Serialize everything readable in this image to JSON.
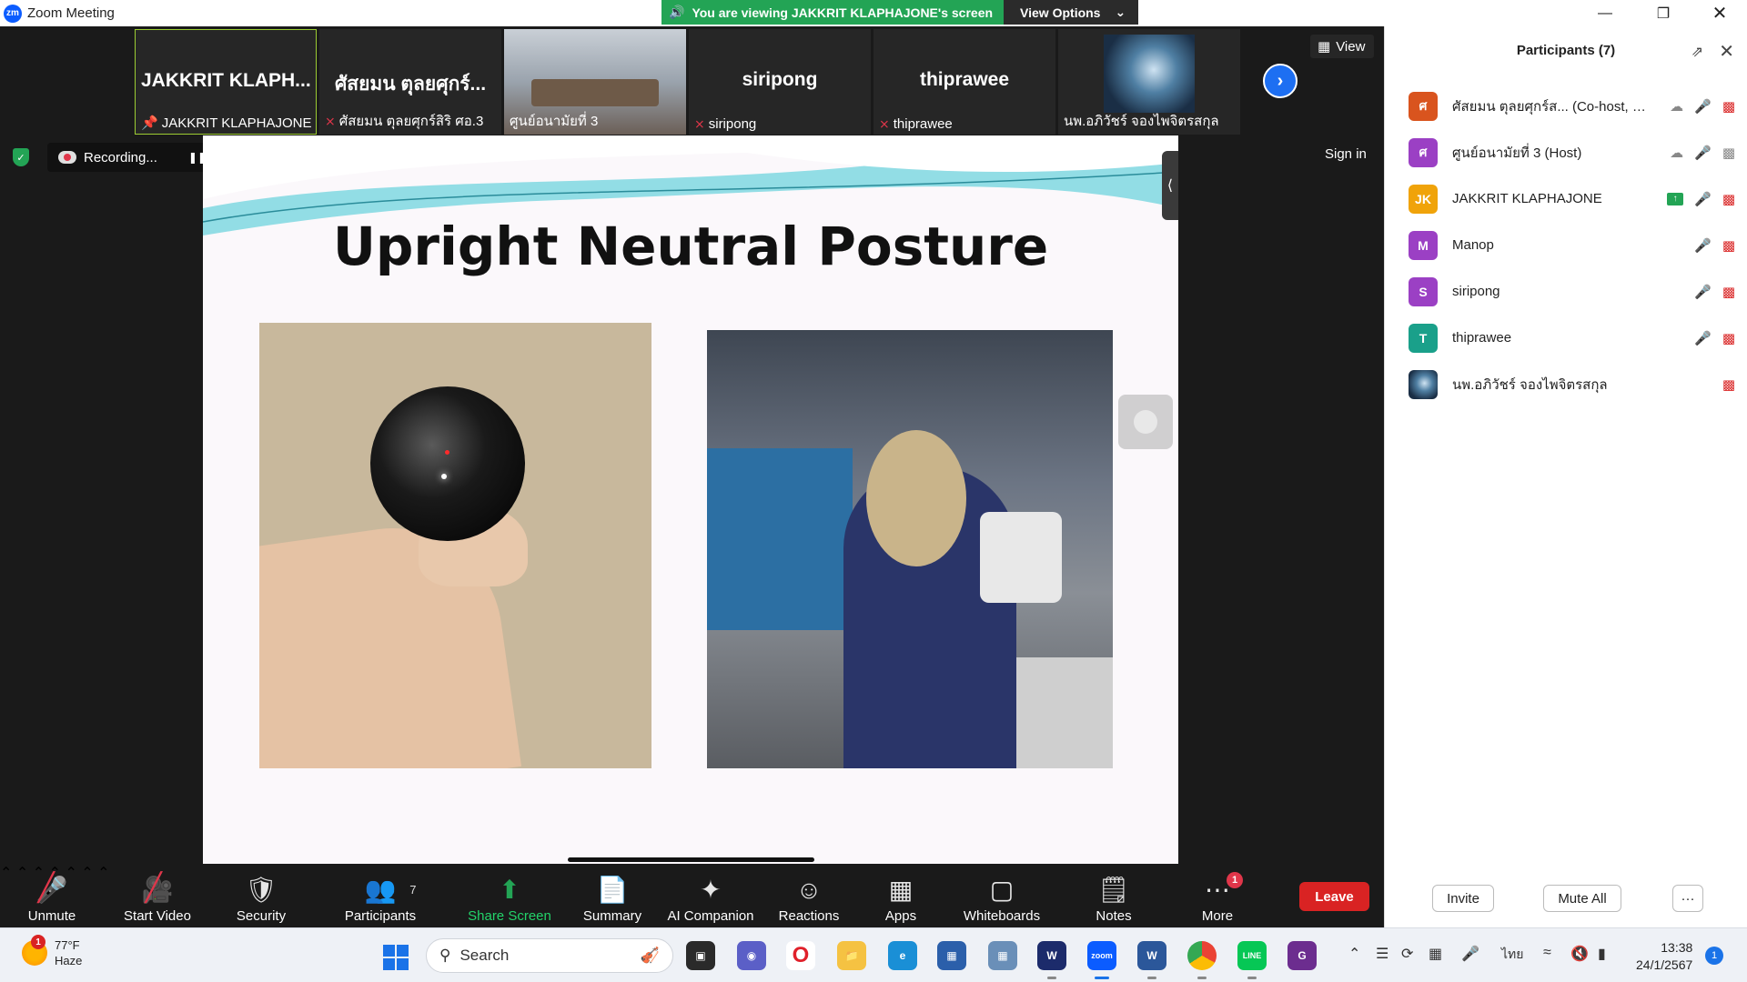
{
  "window": {
    "title": "Zoom Meeting",
    "app_icon": "zm",
    "controls": [
      "minimize-icon",
      "restore-icon",
      "close-icon"
    ]
  },
  "banner": {
    "viewing_text": "You are viewing JAKKRIT KLAPHAJONE's screen",
    "view_options_label": "View Options"
  },
  "thumbnails": [
    {
      "big_name": "JAKKRIT KLAPH...",
      "label": "JAKKRIT KLAPHAJONE",
      "icon": "pin-icon",
      "active": true
    },
    {
      "big_name": "ศัสยมน ตุลยศุกร์...",
      "label": "ศัสยมน ตุลยศุกร์สิริ ศอ.3",
      "icon": "mic-off-icon"
    },
    {
      "big_name": "",
      "label": "ศูนย์อนามัยที่ 3",
      "icon": "",
      "video": "room"
    },
    {
      "big_name": "siripong",
      "label": "siripong",
      "icon": "mic-off-icon"
    },
    {
      "big_name": "thiprawee",
      "label": "thiprawee",
      "icon": "mic-off-icon"
    },
    {
      "big_name": "",
      "label": "นพ.อภิวัชร์ จองไพจิตรสกุล",
      "icon": "",
      "video": "dna"
    }
  ],
  "view_label": "View",
  "recording": {
    "label": "Recording..."
  },
  "sign_in_label": "Sign in",
  "slide": {
    "title": "Upright Neutral Posture"
  },
  "toolbar": {
    "unmute": "Unmute",
    "start_video": "Start Video",
    "security": "Security",
    "participants": "Participants",
    "participants_count": "7",
    "share_screen": "Share Screen",
    "summary": "Summary",
    "ai_companion": "AI Companion",
    "reactions": "Reactions",
    "apps": "Apps",
    "whiteboards": "Whiteboards",
    "notes": "Notes",
    "more": "More",
    "more_badge": "1",
    "leave": "Leave"
  },
  "panel": {
    "title": "Participants (7)",
    "participants": [
      {
        "initial": "ศ",
        "color": "#d9541e",
        "name": "ศัสยมน ตุลยศุกร์ส... (Co-host, me)"
      },
      {
        "initial": "ศ",
        "color": "#9b40c4",
        "name": "ศูนย์อนามัยที่ 3 (Host)"
      },
      {
        "initial": "JK",
        "color": "#f0a30a",
        "name": "JAKKRIT KLAPHAJONE"
      },
      {
        "initial": "M",
        "color": "#9b40c4",
        "name": "Manop"
      },
      {
        "initial": "S",
        "color": "#9b40c4",
        "name": "siripong"
      },
      {
        "initial": "T",
        "color": "#1aa08a",
        "name": "thiprawee"
      },
      {
        "initial": "",
        "color": "",
        "name": "นพ.อภิวัชร์ จองไพจิตรสกุล"
      }
    ],
    "invite": "Invite",
    "mute_all": "Mute All",
    "more": "···"
  },
  "taskbar": {
    "weather_badge": "1",
    "temperature": "77°F",
    "condition": "Haze",
    "search_placeholder": "Search",
    "language": "ไทย",
    "time": "13:38",
    "date": "24/1/2567",
    "notification_count": "1"
  }
}
